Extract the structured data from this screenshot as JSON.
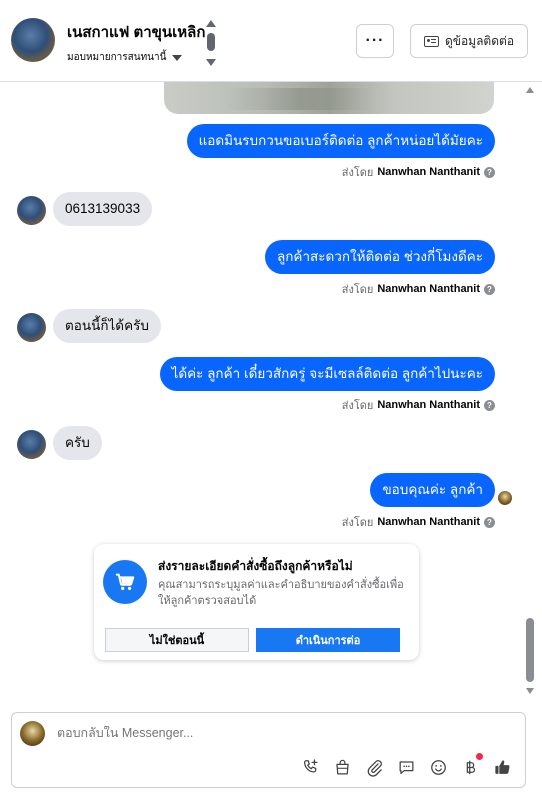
{
  "header": {
    "contact_name": "เนสกาแฟ ตาขุนเหลิก",
    "assign_label": "มอบหมายการสนทนานี้",
    "more_label": "···",
    "contact_info_label": "ดูข้อมูลติดต่อ"
  },
  "thread": {
    "sent_by_prefix": "ส่งโดย",
    "sender_name": "Nanwhan Nanthanit",
    "info_glyph": "?",
    "messages": [
      {
        "dir": "out",
        "text": "แอดมินรบกวนขอเบอร์ติดต่อ ลูกค้าหน่อยได้มัยคะ"
      },
      {
        "dir": "in",
        "text": "0613139033"
      },
      {
        "dir": "out",
        "text": "ลูกค้าสะดวกให้ติดต่อ ช่วงกี่โมงดีคะ"
      },
      {
        "dir": "in",
        "text": "ตอนนี้ก็ได้ครับ"
      },
      {
        "dir": "out",
        "text": "ได้ค่ะ ลูกค้า เดี๋ยวสักครู่ จะมีเซลล์ติดต่อ ลูกค้าไปนะคะ"
      },
      {
        "dir": "in",
        "text": "ครับ"
      },
      {
        "dir": "out",
        "text": "ขอบคุณค่ะ ลูกค้า"
      }
    ]
  },
  "prompt_card": {
    "title": "ส่งรายละเอียดคำสั่งซื้อถึงลูกค้าหรือไม่",
    "body": "คุณสามารถระบุมูลค่าและคำอธิบายของคำสั่งซื้อเพื่อให้ลูกค้าตรวจสอบได้",
    "secondary_button": "ไม่ใช่ตอนนี้",
    "primary_button": "ดำเนินการต่อ"
  },
  "composer": {
    "placeholder": "ตอบกลับใน Messenger..."
  },
  "icons": [
    "phone-plus-icon",
    "shopping-bag-icon",
    "paperclip-icon",
    "saved-reply-icon",
    "emoji-icon",
    "baht-icon",
    "thumbs-up-icon",
    "cart-icon",
    "info-icon",
    "contact-card-icon",
    "chevron-down-icon"
  ],
  "colors": {
    "brand_blue": "#0866ff",
    "button_blue": "#1877f2",
    "incoming_bubble": "#e4e6eb",
    "notification_dot": "#f02849"
  }
}
